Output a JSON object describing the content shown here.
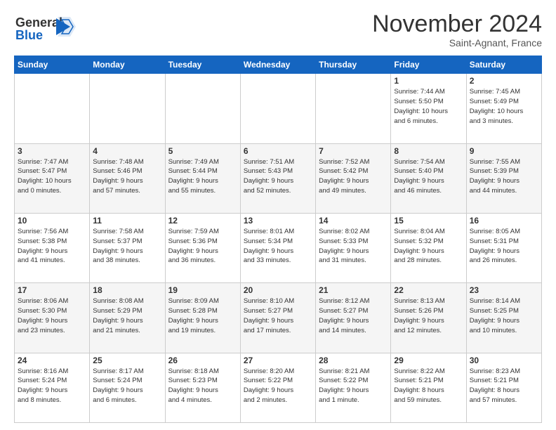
{
  "header": {
    "logo_text_general": "General",
    "logo_text_blue": "Blue",
    "month": "November 2024",
    "location": "Saint-Agnant, France"
  },
  "days_of_week": [
    "Sunday",
    "Monday",
    "Tuesday",
    "Wednesday",
    "Thursday",
    "Friday",
    "Saturday"
  ],
  "rows": [
    [
      {
        "day": "",
        "info": ""
      },
      {
        "day": "",
        "info": ""
      },
      {
        "day": "",
        "info": ""
      },
      {
        "day": "",
        "info": ""
      },
      {
        "day": "",
        "info": ""
      },
      {
        "day": "1",
        "info": "Sunrise: 7:44 AM\nSunset: 5:50 PM\nDaylight: 10 hours\nand 6 minutes."
      },
      {
        "day": "2",
        "info": "Sunrise: 7:45 AM\nSunset: 5:49 PM\nDaylight: 10 hours\nand 3 minutes."
      }
    ],
    [
      {
        "day": "3",
        "info": "Sunrise: 7:47 AM\nSunset: 5:47 PM\nDaylight: 10 hours\nand 0 minutes."
      },
      {
        "day": "4",
        "info": "Sunrise: 7:48 AM\nSunset: 5:46 PM\nDaylight: 9 hours\nand 57 minutes."
      },
      {
        "day": "5",
        "info": "Sunrise: 7:49 AM\nSunset: 5:44 PM\nDaylight: 9 hours\nand 55 minutes."
      },
      {
        "day": "6",
        "info": "Sunrise: 7:51 AM\nSunset: 5:43 PM\nDaylight: 9 hours\nand 52 minutes."
      },
      {
        "day": "7",
        "info": "Sunrise: 7:52 AM\nSunset: 5:42 PM\nDaylight: 9 hours\nand 49 minutes."
      },
      {
        "day": "8",
        "info": "Sunrise: 7:54 AM\nSunset: 5:40 PM\nDaylight: 9 hours\nand 46 minutes."
      },
      {
        "day": "9",
        "info": "Sunrise: 7:55 AM\nSunset: 5:39 PM\nDaylight: 9 hours\nand 44 minutes."
      }
    ],
    [
      {
        "day": "10",
        "info": "Sunrise: 7:56 AM\nSunset: 5:38 PM\nDaylight: 9 hours\nand 41 minutes."
      },
      {
        "day": "11",
        "info": "Sunrise: 7:58 AM\nSunset: 5:37 PM\nDaylight: 9 hours\nand 38 minutes."
      },
      {
        "day": "12",
        "info": "Sunrise: 7:59 AM\nSunset: 5:36 PM\nDaylight: 9 hours\nand 36 minutes."
      },
      {
        "day": "13",
        "info": "Sunrise: 8:01 AM\nSunset: 5:34 PM\nDaylight: 9 hours\nand 33 minutes."
      },
      {
        "day": "14",
        "info": "Sunrise: 8:02 AM\nSunset: 5:33 PM\nDaylight: 9 hours\nand 31 minutes."
      },
      {
        "day": "15",
        "info": "Sunrise: 8:04 AM\nSunset: 5:32 PM\nDaylight: 9 hours\nand 28 minutes."
      },
      {
        "day": "16",
        "info": "Sunrise: 8:05 AM\nSunset: 5:31 PM\nDaylight: 9 hours\nand 26 minutes."
      }
    ],
    [
      {
        "day": "17",
        "info": "Sunrise: 8:06 AM\nSunset: 5:30 PM\nDaylight: 9 hours\nand 23 minutes."
      },
      {
        "day": "18",
        "info": "Sunrise: 8:08 AM\nSunset: 5:29 PM\nDaylight: 9 hours\nand 21 minutes."
      },
      {
        "day": "19",
        "info": "Sunrise: 8:09 AM\nSunset: 5:28 PM\nDaylight: 9 hours\nand 19 minutes."
      },
      {
        "day": "20",
        "info": "Sunrise: 8:10 AM\nSunset: 5:27 PM\nDaylight: 9 hours\nand 17 minutes."
      },
      {
        "day": "21",
        "info": "Sunrise: 8:12 AM\nSunset: 5:27 PM\nDaylight: 9 hours\nand 14 minutes."
      },
      {
        "day": "22",
        "info": "Sunrise: 8:13 AM\nSunset: 5:26 PM\nDaylight: 9 hours\nand 12 minutes."
      },
      {
        "day": "23",
        "info": "Sunrise: 8:14 AM\nSunset: 5:25 PM\nDaylight: 9 hours\nand 10 minutes."
      }
    ],
    [
      {
        "day": "24",
        "info": "Sunrise: 8:16 AM\nSunset: 5:24 PM\nDaylight: 9 hours\nand 8 minutes."
      },
      {
        "day": "25",
        "info": "Sunrise: 8:17 AM\nSunset: 5:24 PM\nDaylight: 9 hours\nand 6 minutes."
      },
      {
        "day": "26",
        "info": "Sunrise: 8:18 AM\nSunset: 5:23 PM\nDaylight: 9 hours\nand 4 minutes."
      },
      {
        "day": "27",
        "info": "Sunrise: 8:20 AM\nSunset: 5:22 PM\nDaylight: 9 hours\nand 2 minutes."
      },
      {
        "day": "28",
        "info": "Sunrise: 8:21 AM\nSunset: 5:22 PM\nDaylight: 9 hours\nand 1 minute."
      },
      {
        "day": "29",
        "info": "Sunrise: 8:22 AM\nSunset: 5:21 PM\nDaylight: 8 hours\nand 59 minutes."
      },
      {
        "day": "30",
        "info": "Sunrise: 8:23 AM\nSunset: 5:21 PM\nDaylight: 8 hours\nand 57 minutes."
      }
    ]
  ]
}
